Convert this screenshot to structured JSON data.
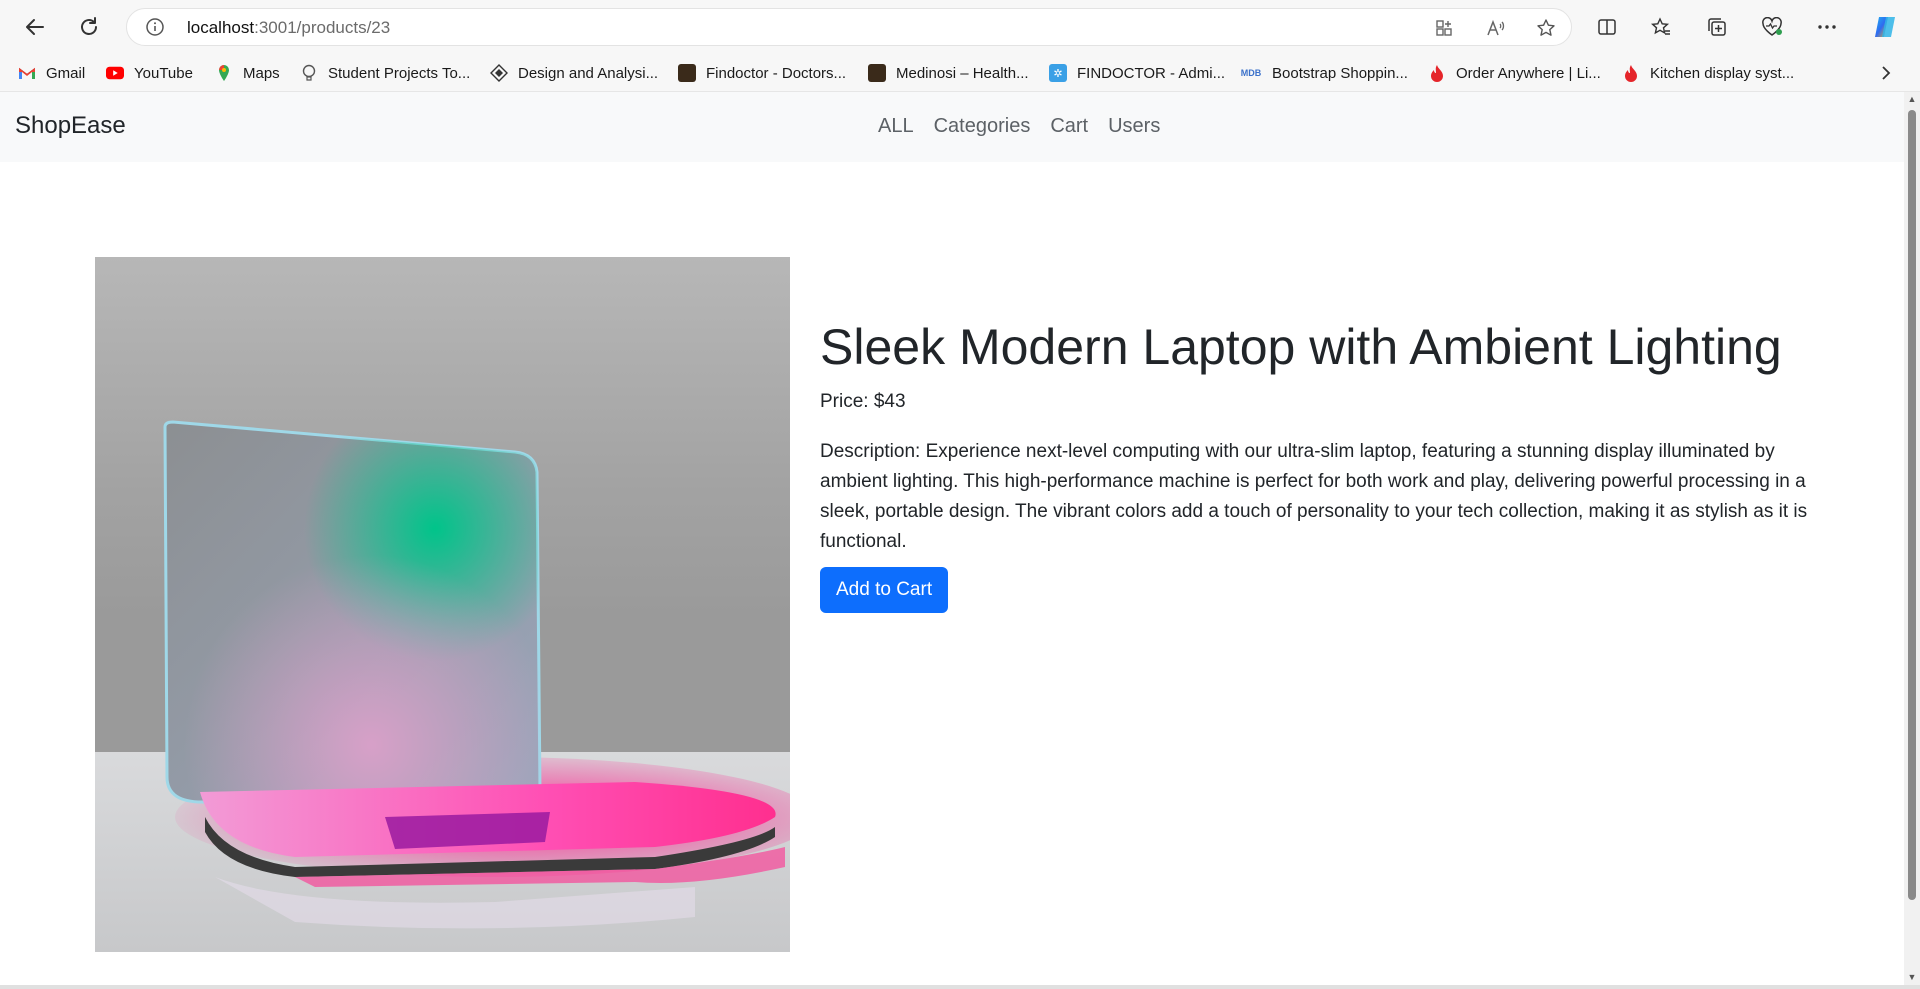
{
  "browser": {
    "url_host": "localhost",
    "url_path": ":3001/products/23",
    "bookmarks": [
      {
        "label": "Gmail",
        "icon": "gmail-icon"
      },
      {
        "label": "YouTube",
        "icon": "youtube-icon"
      },
      {
        "label": "Maps",
        "icon": "maps-icon"
      },
      {
        "label": "Student Projects To...",
        "icon": "bulb-icon"
      },
      {
        "label": "Design and Analysi...",
        "icon": "diamond-icon"
      },
      {
        "label": "Findoctor - Doctors...",
        "icon": "findoctor-icon"
      },
      {
        "label": "Medinosi – Health...",
        "icon": "medinosi-icon"
      },
      {
        "label": "FINDOCTOR - Admi...",
        "icon": "admin-icon"
      },
      {
        "label": "Bootstrap Shoppin...",
        "icon": "mdb-icon"
      },
      {
        "label": "Order Anywhere | Li...",
        "icon": "flame-icon"
      },
      {
        "label": "Kitchen display syst...",
        "icon": "flame-icon"
      }
    ]
  },
  "navbar": {
    "brand": "ShopEase",
    "links": [
      "ALL",
      "Categories",
      "Cart",
      "Users"
    ]
  },
  "product": {
    "title": "Sleek Modern Laptop with Ambient Lighting",
    "price": "Price: $43",
    "description": "Description: Experience next-level computing with our ultra-slim laptop, featuring a stunning display illuminated by ambient lighting. This high-performance machine is perfect for both work and play, delivering powerful processing in a sleek, portable design. The vibrant colors add a touch of personality to your tech collection, making it as stylish as it is functional.",
    "add_to_cart": "Add to Cart"
  },
  "colors": {
    "primary_button": "#0d6efd",
    "navbar_bg": "#f8f9fa",
    "text": "#212529",
    "nav_link": "#5c6166"
  }
}
